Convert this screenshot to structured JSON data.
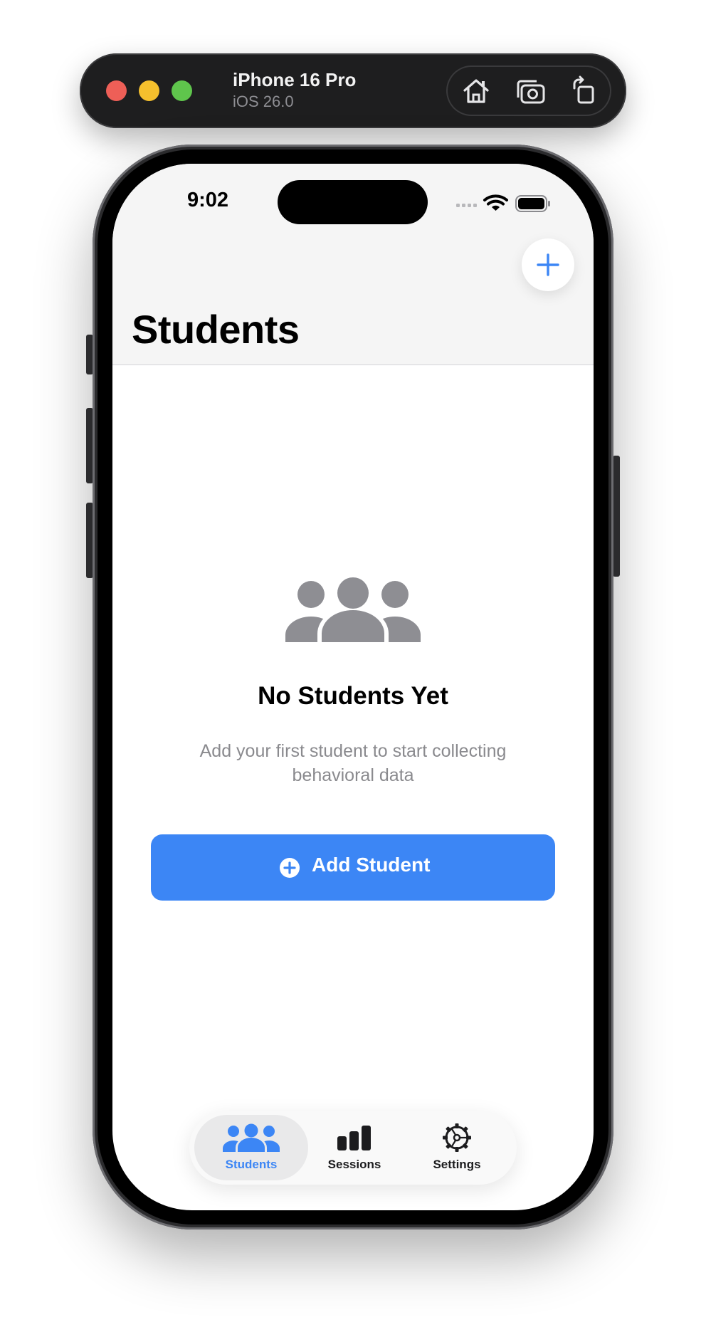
{
  "simulator": {
    "device_name": "iPhone 16 Pro",
    "os_version": "iOS 26.0",
    "controls": [
      "home-icon",
      "screenshot-icon",
      "rotate-icon"
    ]
  },
  "status_bar": {
    "time": "9:02",
    "icons": [
      "cellular-icon",
      "wifi-icon",
      "battery-icon"
    ]
  },
  "header": {
    "title": "Students",
    "add_button_icon": "plus-icon"
  },
  "empty_state": {
    "icon": "people-icon",
    "title": "No Students Yet",
    "subtitle": "Add your first student to start collecting behavioral data",
    "button_label": "Add Student",
    "button_icon": "plus-circle-icon"
  },
  "tab_bar": {
    "tabs": [
      {
        "label": "Students",
        "icon": "people-icon",
        "active": true
      },
      {
        "label": "Sessions",
        "icon": "chart-bar-icon",
        "active": false
      },
      {
        "label": "Settings",
        "icon": "gear-icon",
        "active": false
      }
    ]
  },
  "colors": {
    "accent": "#3c86f5",
    "secondary_text": "#8a8a8e",
    "illustration_gray": "#8e8e93"
  }
}
